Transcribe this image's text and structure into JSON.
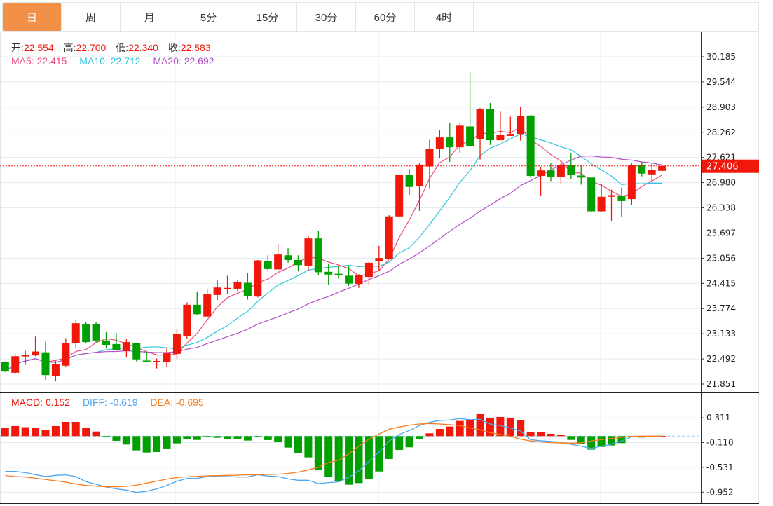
{
  "tabs": [
    {
      "label": "日",
      "active": true
    },
    {
      "label": "周"
    },
    {
      "label": "月"
    },
    {
      "label": "5分"
    },
    {
      "label": "15分"
    },
    {
      "label": "30分"
    },
    {
      "label": "60分"
    },
    {
      "label": "4时"
    }
  ],
  "ohlc_legend": {
    "open_label": "开:",
    "open": "22.554",
    "high_label": "高:",
    "high": "22.700",
    "low_label": "低:",
    "low": "22.340",
    "close_label": "收:",
    "close": "22.583"
  },
  "ma_legend": {
    "ma5": "MA5: 22.415",
    "ma10": "MA10: 22.712",
    "ma20": "MA20: 22.692"
  },
  "macd_legend": {
    "macd": "MACD: 0.152",
    "diff": "DIFF: -0.619",
    "dea": "DEA: -0.695"
  },
  "current_price": "27.406",
  "colors": {
    "up": "#f0180a",
    "down": "#00a000",
    "ma5": "#ee4d7d",
    "ma10": "#2ec7dc",
    "ma20": "#b34fc6",
    "diff": "#4ea6f0",
    "dea": "#f77b1e",
    "tab_active": "#f39047"
  },
  "chart_data": [
    {
      "type": "candlestick",
      "y_ticks": [
        "30.185",
        "29.544",
        "28.903",
        "28.262",
        "27.621",
        "26.980",
        "26.338",
        "25.697",
        "25.056",
        "24.415",
        "23.774",
        "23.133",
        "22.492",
        "21.851"
      ],
      "ylim": [
        21.851,
        30.185
      ],
      "grid": true,
      "series_format": "[open, high, low, close]",
      "candles": [
        [
          22.41,
          22.43,
          22.16,
          22.17
        ],
        [
          22.14,
          22.61,
          22.12,
          22.56
        ],
        [
          22.554,
          22.7,
          22.34,
          22.583
        ],
        [
          22.58,
          23.06,
          22.56,
          22.68
        ],
        [
          22.66,
          22.93,
          21.96,
          22.08
        ],
        [
          22.06,
          22.44,
          21.92,
          22.35
        ],
        [
          22.32,
          23.02,
          22.3,
          22.9
        ],
        [
          22.9,
          23.49,
          22.77,
          23.4
        ],
        [
          23.38,
          23.43,
          22.9,
          22.92
        ],
        [
          23.38,
          23.43,
          22.9,
          22.96
        ],
        [
          22.96,
          23.17,
          22.77,
          22.85
        ],
        [
          22.87,
          23.15,
          22.71,
          22.72
        ],
        [
          22.69,
          22.99,
          22.54,
          22.92
        ],
        [
          22.9,
          22.9,
          22.43,
          22.48
        ],
        [
          22.45,
          22.68,
          22.4,
          22.41
        ],
        [
          22.42,
          22.5,
          22.25,
          22.44
        ],
        [
          22.42,
          22.78,
          22.29,
          22.65
        ],
        [
          22.62,
          23.25,
          22.49,
          23.12
        ],
        [
          23.08,
          23.93,
          23.0,
          23.87
        ],
        [
          23.87,
          24.21,
          23.61,
          23.63
        ],
        [
          23.57,
          24.28,
          23.55,
          24.15
        ],
        [
          24.12,
          24.49,
          23.99,
          24.31
        ],
        [
          24.27,
          24.61,
          24.15,
          24.3
        ],
        [
          24.28,
          24.5,
          24.22,
          24.44
        ],
        [
          24.43,
          24.67,
          24.0,
          24.1
        ],
        [
          24.08,
          25.01,
          24.06,
          25.0
        ],
        [
          24.98,
          25.13,
          24.73,
          24.78
        ],
        [
          24.77,
          25.42,
          24.77,
          25.15
        ],
        [
          25.13,
          25.31,
          24.94,
          25.01
        ],
        [
          25.01,
          25.13,
          24.72,
          24.88
        ],
        [
          24.86,
          25.62,
          24.73,
          25.56
        ],
        [
          25.56,
          25.75,
          24.62,
          24.7
        ],
        [
          24.71,
          24.92,
          24.38,
          24.64
        ],
        [
          24.66,
          24.85,
          24.54,
          24.65
        ],
        [
          24.61,
          24.86,
          24.35,
          24.41
        ],
        [
          24.4,
          24.65,
          24.3,
          24.63
        ],
        [
          24.58,
          24.99,
          24.37,
          24.94
        ],
        [
          24.98,
          25.37,
          24.73,
          25.06
        ],
        [
          25.04,
          26.15,
          25.04,
          26.12
        ],
        [
          26.12,
          27.18,
          26.1,
          27.17
        ],
        [
          27.17,
          27.32,
          26.67,
          26.87
        ],
        [
          26.9,
          27.47,
          26.26,
          27.44
        ],
        [
          27.39,
          28.07,
          26.84,
          27.84
        ],
        [
          27.83,
          28.32,
          27.6,
          28.13
        ],
        [
          28.13,
          28.51,
          27.51,
          27.88
        ],
        [
          27.88,
          28.49,
          27.73,
          28.43
        ],
        [
          28.41,
          29.79,
          27.91,
          27.91
        ],
        [
          28.08,
          28.88,
          27.57,
          28.85
        ],
        [
          28.85,
          29.01,
          27.94,
          28.06
        ],
        [
          28.06,
          28.79,
          28.06,
          28.2
        ],
        [
          28.17,
          28.66,
          28.17,
          28.22
        ],
        [
          28.22,
          28.92,
          28.05,
          28.67
        ],
        [
          28.69,
          28.7,
          27.1,
          27.15
        ],
        [
          27.15,
          27.37,
          26.65,
          27.29
        ],
        [
          27.29,
          27.47,
          27.02,
          27.13
        ],
        [
          27.13,
          27.56,
          26.96,
          27.42
        ],
        [
          27.42,
          27.72,
          27.07,
          27.17
        ],
        [
          27.16,
          27.42,
          26.93,
          27.11
        ],
        [
          27.11,
          27.13,
          26.22,
          26.25
        ],
        [
          26.25,
          26.95,
          26.23,
          26.62
        ],
        [
          26.62,
          26.8,
          26.01,
          26.66
        ],
        [
          26.65,
          26.85,
          26.11,
          26.51
        ],
        [
          26.56,
          27.47,
          26.41,
          27.42
        ],
        [
          27.42,
          27.51,
          27.14,
          27.21
        ],
        [
          27.19,
          27.47,
          27.0,
          27.31
        ],
        [
          27.28,
          27.42,
          27.28,
          27.406
        ]
      ],
      "moving_averages": [
        "MA5",
        "MA10",
        "MA20"
      ]
    },
    {
      "type": "bar+line",
      "y_ticks": [
        "0.311",
        "-0.110",
        "-0.531",
        "-0.952"
      ],
      "grid": true,
      "macd": [
        0.135,
        0.171,
        0.152,
        0.135,
        0.099,
        0.171,
        0.242,
        0.242,
        0.135,
        0.079,
        -0.005,
        -0.079,
        -0.143,
        -0.242,
        -0.278,
        -0.27,
        -0.21,
        -0.123,
        -0.052,
        -0.064,
        -0.02,
        -0.028,
        -0.044,
        -0.052,
        -0.075,
        -0.008,
        -0.067,
        -0.099,
        -0.195,
        -0.282,
        -0.361,
        -0.58,
        -0.687,
        -0.766,
        -0.826,
        -0.798,
        -0.726,
        -0.6,
        -0.389,
        -0.234,
        -0.19,
        -0.052,
        0.048,
        0.123,
        0.163,
        0.258,
        0.274,
        0.373,
        0.306,
        0.326,
        0.314,
        0.266,
        0.075,
        0.071,
        0.04,
        0.024,
        -0.064,
        -0.135,
        -0.23,
        -0.183,
        -0.159,
        -0.119,
        -0.012,
        -0.024,
        -0.004,
        0.002
      ],
      "diff": [
        -0.6,
        -0.6,
        -0.619,
        -0.655,
        -0.687,
        -0.667,
        -0.659,
        -0.687,
        -0.774,
        -0.818,
        -0.865,
        -0.897,
        -0.917,
        -0.957,
        -0.937,
        -0.897,
        -0.838,
        -0.766,
        -0.719,
        -0.719,
        -0.687,
        -0.687,
        -0.687,
        -0.695,
        -0.695,
        -0.655,
        -0.679,
        -0.687,
        -0.727,
        -0.75,
        -0.75,
        -0.806,
        -0.79,
        -0.778,
        -0.699,
        -0.588,
        -0.429,
        -0.27,
        -0.083,
        0.028,
        0.095,
        0.179,
        0.234,
        0.266,
        0.274,
        0.298,
        0.278,
        0.286,
        0.206,
        0.179,
        0.139,
        0.087,
        -0.06,
        -0.079,
        -0.091,
        -0.103,
        -0.139,
        -0.171,
        -0.21,
        -0.171,
        -0.139,
        -0.083,
        -0.012,
        -0.004,
        -0.004,
        0
      ],
      "dea": [
        -0.671,
        -0.687,
        -0.695,
        -0.715,
        -0.738,
        -0.758,
        -0.782,
        -0.814,
        -0.838,
        -0.85,
        -0.861,
        -0.861,
        -0.854,
        -0.834,
        -0.798,
        -0.766,
        -0.73,
        -0.703,
        -0.691,
        -0.683,
        -0.675,
        -0.671,
        -0.667,
        -0.663,
        -0.659,
        -0.655,
        -0.651,
        -0.647,
        -0.635,
        -0.611,
        -0.576,
        -0.528,
        -0.449,
        -0.409,
        -0.302,
        -0.171,
        -0.052,
        0.036,
        0.119,
        0.155,
        0.187,
        0.206,
        0.214,
        0.206,
        0.195,
        0.179,
        0.139,
        0.107,
        0.06,
        0.028,
        -0.004,
        -0.052,
        -0.083,
        -0.099,
        -0.111,
        -0.115,
        -0.119,
        -0.115,
        -0.083,
        -0.06,
        -0.04,
        -0.02,
        -0.004,
        0,
        0,
        0
      ]
    }
  ]
}
